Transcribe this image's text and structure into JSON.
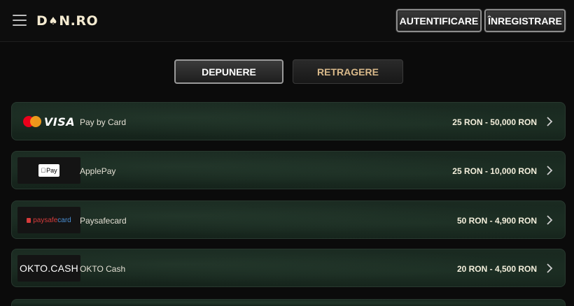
{
  "header": {
    "logo_part1": "D",
    "logo_part2": "N.RO",
    "login_label": "AUTENTIFICARE",
    "register_label": "ÎNREGISTRARE"
  },
  "tabs": {
    "deposit_label": "DEPUNERE",
    "withdraw_label": "RETRAGERE",
    "active": "DEPUNERE"
  },
  "methods": [
    {
      "name": "Pay by Card",
      "range": "25 RON - 50,000 RON",
      "logo_text": "VISA"
    },
    {
      "name": "ApplePay",
      "range": "25 RON - 10,000 RON",
      "logo_text": "Pay"
    },
    {
      "name": "Paysafecard",
      "range": "50 RON - 4,900 RON",
      "logo_text_a": "paysafe",
      "logo_text_b": "card"
    },
    {
      "name": "OKTO Cash",
      "range": "20 RON - 4,500 RON",
      "logo_text": "OKTO.CASH"
    }
  ],
  "colors": {
    "background": "#0b0b0b",
    "card_background": "#17261d",
    "withdraw_text": "#d9b98a",
    "mastercard_red": "#eb001b",
    "mastercard_orange": "#f79e1b"
  },
  "icons": [
    "menu-icon",
    "spade-icon",
    "chevron-right-icon",
    "apple-icon"
  ]
}
